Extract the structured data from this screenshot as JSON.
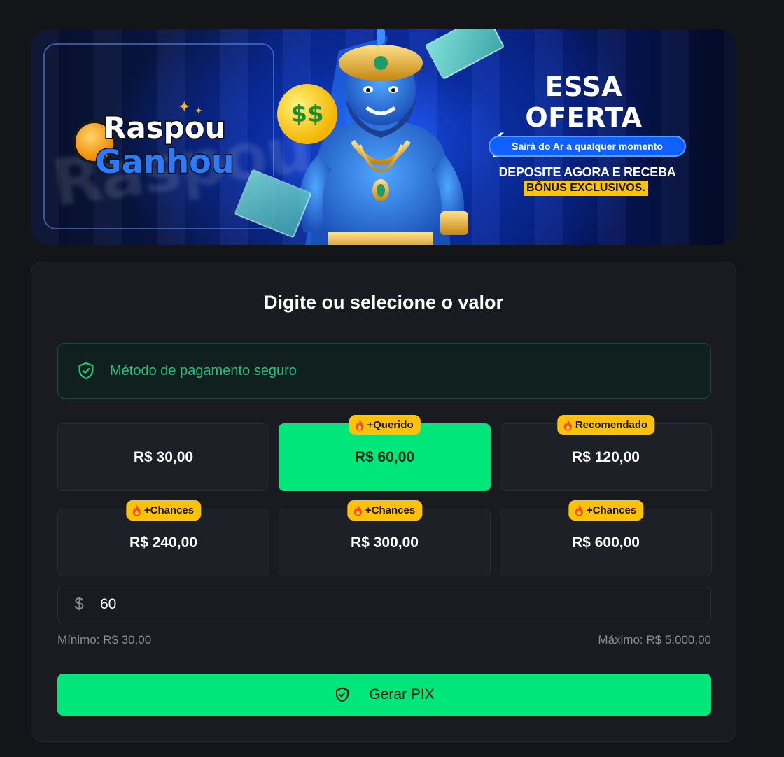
{
  "banner": {
    "logo_line1": "Raspou",
    "logo_line2": "Ganhou",
    "offer_title_line1": "ESSA OFERTA",
    "offer_title_line2": "É LIMITADA!",
    "offer_pill": "Sairá do Ar a qualquer momento",
    "offer_deposit": "DEPOSITE AGORA E RECEBA",
    "offer_bonus": "BÔNUS EXCLUSIVOS."
  },
  "card": {
    "title": "Digite ou selecione o valor",
    "secure_text": "Método de pagamento seguro",
    "amounts": [
      {
        "label": "R$ 30,00",
        "badge": ""
      },
      {
        "label": "R$ 60,00",
        "badge": "+Querido"
      },
      {
        "label": "R$ 120,00",
        "badge": "Recomendado"
      },
      {
        "label": "R$ 240,00",
        "badge": "+Chances"
      },
      {
        "label": "R$ 300,00",
        "badge": "+Chances"
      },
      {
        "label": "R$ 600,00",
        "badge": "+Chances"
      }
    ],
    "selected_amount": "R$ 60,00",
    "input_value": "60",
    "currency_symbol": "$",
    "min_label": "Mínimo: R$ 30,00",
    "max_label": "Máximo: R$ 5.000,00",
    "generate_button": "Gerar PIX"
  },
  "colors": {
    "accent_green": "#00e67a",
    "badge_yellow": "#ffc10a",
    "secure_green": "#22c27a",
    "background": "#141519"
  }
}
